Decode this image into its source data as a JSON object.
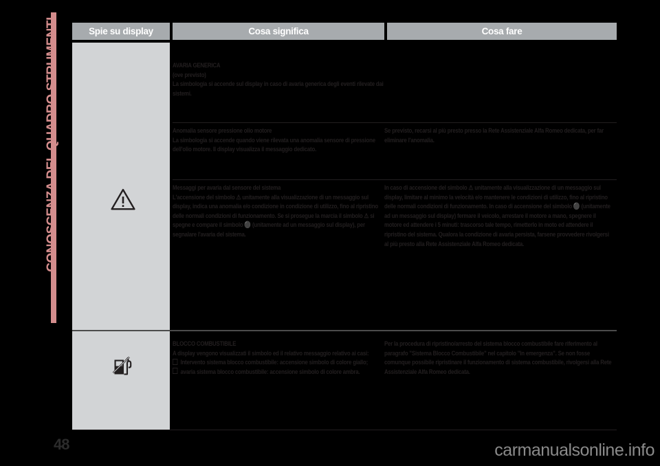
{
  "chapter_tab": {
    "label": "CONOSCENZA DEL QUADRO STRUMENTI",
    "color": "#d48d8d"
  },
  "page": {
    "number": "48",
    "watermark": "carmanualsonline.info",
    "background": "#000000"
  },
  "table": {
    "header_bg": "#a7abae",
    "icon_column_bg": "#d2d4d6",
    "columns": [
      {
        "key": "spie",
        "label": "Spie su display"
      },
      {
        "key": "cosa_significa",
        "label": "Cosa significa"
      },
      {
        "key": "cosa_fare",
        "label": "Cosa fare"
      }
    ],
    "blocks": [
      {
        "icon": "warning-triangle-icon",
        "rows": [
          {
            "means_heading": "AVARIA GENERICA",
            "means_subheading": "(ove previsto)",
            "means_body": "La simbologia si accende sul display in caso di avaria generica degli eventi rilevate dai sistemi.",
            "do_body": ""
          },
          {
            "means_heading": "Anomalia sensore pressione olio motore",
            "means_body": "La simbologia si accende quando viene rilevata una anomalia sensore di pressione dell'olio motore. Il display visualizza il messaggio dedicato.",
            "do_body": "Se previsto, recarsi al più presto presso la Rete Assistenziale Alfa Romeo dedicata, per far eliminare l'anomalia."
          },
          {
            "means_heading": "Messaggi per avaria dal sensore del sistema",
            "means_body": "L'accensione del simbolo ⚠ unitamente alla visualizzazione di un messaggio sul display, indica una anomalia e/o condizione in condizione di utilizzo, fino al ripristino delle normali condizioni di funzionamento. Se si prosegue la marcia il simbolo ⚠ si spegne e compare il simbolo ⚫ (unitamente ad un messaggio sul display), per segnalare l'avaria del sistema.",
            "do_body": "In caso di accensione del simbolo ⚠ unitamente alla visualizzazione di un messaggio sul display, limitare al minimo la velocità e/o mantenere le condizioni di utilizzo, fino al ripristino delle normali condizioni di funzionamento. In caso di accensione del simbolo ⚫ (unitamente ad un messaggio sul display) fermare il veicolo, arrestare il motore a mano, spegnere il motore ed attendere i 5 minuti: trascorso tale tempo, rimetterlo in moto ed attendere il ripristino del sistema. Qualora la condizione di avaria persista, farsene provvedere rivolgersi al più presto alla Rete Assistenziale Alfa Romeo dedicata."
          }
        ]
      },
      {
        "icon": "fuel-cutoff-icon",
        "rows": [
          {
            "means_heading": "BLOCCO COMBUSTIBILE",
            "means_body": "A display vengono visualizzati il simbolo ed il relativo messaggio relativo ai casi:",
            "means_bullets": [
              "Intervento sistema blocco combustibile: accensione simbolo di colore giallo;",
              "avaria sistema blocco combustibile: accensione simbolo di colore ambra."
            ],
            "do_body": "Per la procedura di ripristino/arresto del sistema blocco combustibile fare riferimento al paragrafo \"Sistema Blocco Combustibile\" nel capitolo \"In emergenza\". Se non fosse comunque possibile ripristinare il funzionamento di sistema combustibile, rivolgersi alla Rete Assistenziale Alfa Romeo dedicata."
          }
        ]
      }
    ]
  }
}
